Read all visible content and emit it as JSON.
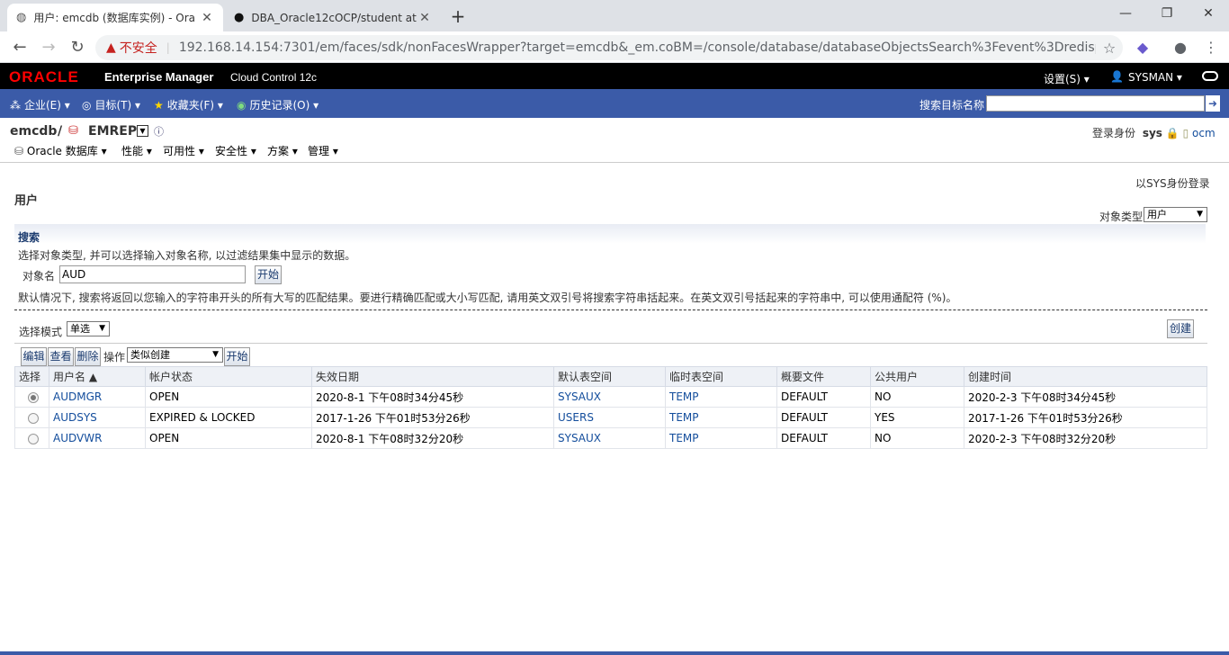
{
  "browser": {
    "tabs": [
      {
        "label": "用户: emcdb (数据库实例) - Ora",
        "active": true
      },
      {
        "label": "DBA_Oracle12cOCP/student at",
        "active": false
      }
    ],
    "new_tab": "+",
    "window": {
      "minimize": "—",
      "maximize": "❐",
      "close": "✕"
    },
    "security_label": "不安全",
    "url": "192.168.14.154:7301/em/faces/sdk/nonFacesWrapper?target=emcdb&_em.coBM=/console/database/databaseObjectsSearch%3Fevent%3Dredispla..."
  },
  "em_header": {
    "logo": "ORACLE",
    "product": "Enterprise Manager",
    "edition": "Cloud Control 12c",
    "settings": "设置(S) ▾",
    "user": "SYSMAN ▾"
  },
  "menubar": {
    "items": [
      {
        "label": "企业(E) ▾",
        "icon": "enterprise-icon"
      },
      {
        "label": "目标(T) ▾",
        "icon": "target-icon"
      },
      {
        "label": "收藏夹(F) ▾",
        "icon": "star-icon"
      },
      {
        "label": "历史记录(O) ▾",
        "icon": "history-icon"
      }
    ],
    "search_label": "搜索目标名称"
  },
  "target": {
    "name": "emcdb",
    "sep": "/",
    "sub": "EMREP",
    "login_as_prefix": "登录身份",
    "login_user": "sys",
    "host": "ocm",
    "nav": [
      "Oracle 数据库 ▾",
      "性能 ▾",
      "可用性 ▾",
      "安全性 ▾",
      "方案 ▾",
      "管理 ▾"
    ]
  },
  "page": {
    "title": "用户",
    "login_as": "以SYS身份登录",
    "object_type_label": "对象类型",
    "object_type_value": "用户",
    "search_header": "搜索",
    "hint1": "选择对象类型, 并可以选择输入对象名称, 以过滤结果集中显示的数据。",
    "object_name_label": "对象名",
    "object_name_value": "AUD",
    "go_label": "开始",
    "hint2": "默认情况下, 搜索将返回以您输入的字符串开头的所有大写的匹配结果。要进行精确匹配或大小写匹配, 请用英文双引号将搜索字符串括起来。在英文双引号括起来的字符串中, 可以使用通配符 (%)。",
    "select_mode_label": "选择模式",
    "select_mode_value": "单选",
    "create_label": "创建",
    "edit_label": "编辑",
    "view_label": "查看",
    "delete_label": "删除",
    "actions_label": "操作",
    "actions_value": "类似创建",
    "actions_go": "开始"
  },
  "table": {
    "headers": [
      "选择",
      "用户名 ▲",
      "帐户状态",
      "失效日期",
      "默认表空间",
      "临时表空间",
      "概要文件",
      "公共用户",
      "创建时间"
    ],
    "rows": [
      {
        "selected": true,
        "user": "AUDMGR",
        "status": "OPEN",
        "expiry": "2020-8-1 下午08时34分45秒",
        "default_ts": "SYSAUX",
        "temp_ts": "TEMP",
        "profile": "DEFAULT",
        "common": "NO",
        "created": "2020-2-3 下午08时34分45秒"
      },
      {
        "selected": false,
        "user": "AUDSYS",
        "status": "EXPIRED & LOCKED",
        "expiry": "2017-1-26 下午01时53分26秒",
        "default_ts": "USERS",
        "temp_ts": "TEMP",
        "profile": "DEFAULT",
        "common": "YES",
        "created": "2017-1-26 下午01时53分26秒"
      },
      {
        "selected": false,
        "user": "AUDVWR",
        "status": "OPEN",
        "expiry": "2020-8-1 下午08时32分20秒",
        "default_ts": "SYSAUX",
        "temp_ts": "TEMP",
        "profile": "DEFAULT",
        "common": "NO",
        "created": "2020-2-3 下午08时32分20秒"
      }
    ]
  }
}
